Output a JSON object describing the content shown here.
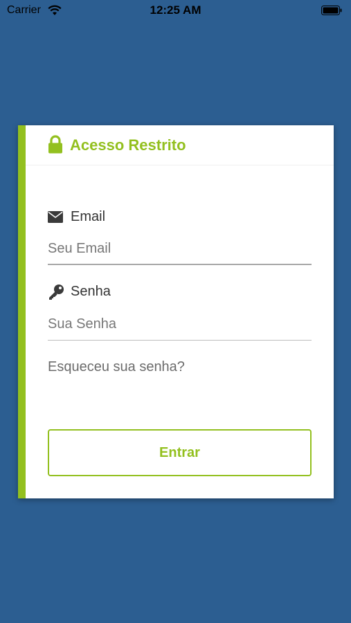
{
  "status_bar": {
    "carrier": "Carrier",
    "time": "12:25 AM"
  },
  "login_card": {
    "title": "Acesso Restrito",
    "title_icon": "lock-icon",
    "accent_color": "#93c01f",
    "email": {
      "label": "Email",
      "icon": "envelope-icon",
      "placeholder": "Seu Email",
      "value": ""
    },
    "password": {
      "label": "Senha",
      "icon": "key-icon",
      "placeholder": "Sua Senha",
      "value": ""
    },
    "forgot_password_label": "Esqueceu sua senha?",
    "submit_label": "Entrar"
  },
  "background_color": "#2c5e91"
}
